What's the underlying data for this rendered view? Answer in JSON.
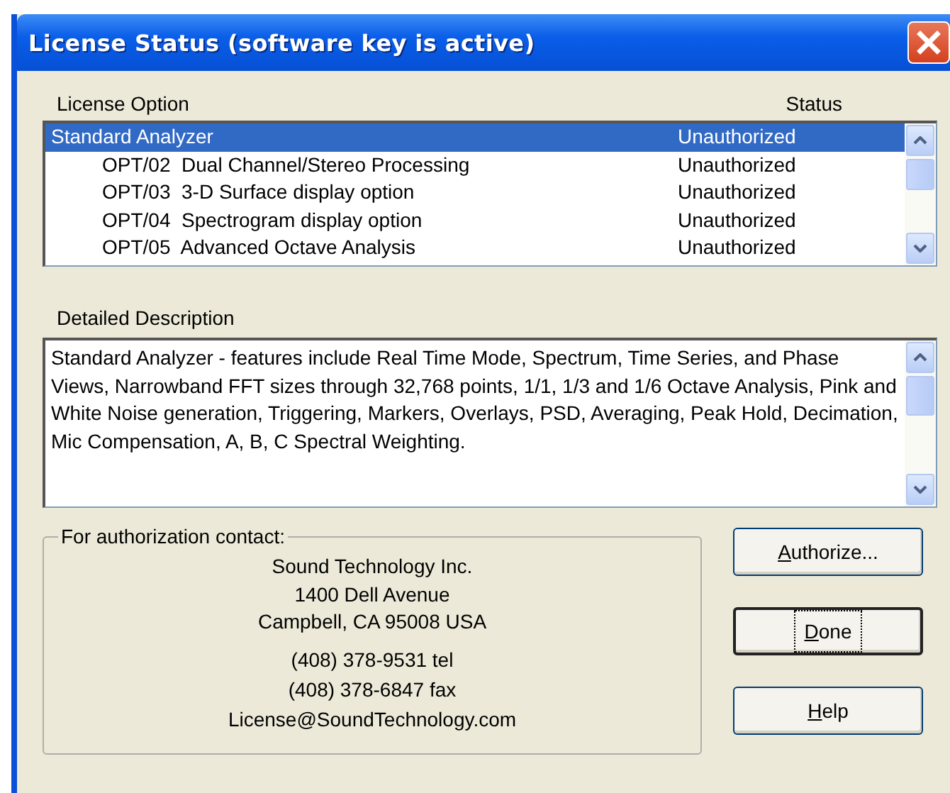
{
  "window": {
    "title": "License Status (software key is active)"
  },
  "license_list": {
    "columns": [
      "License Option",
      "Status"
    ],
    "rows": [
      {
        "name": "Standard Analyzer",
        "status": "Unauthorized",
        "selected": true,
        "children": [
          {
            "name": "OPT/02  Dual Channel/Stereo Processing",
            "status": "Unauthorized",
            "selected": false
          },
          {
            "name": "OPT/03  3-D Surface display option",
            "status": "Unauthorized",
            "selected": false
          },
          {
            "name": "OPT/04  Spectrogram display option",
            "status": "Unauthorized",
            "selected": false
          },
          {
            "name": "OPT/05  Advanced Octave Analysis",
            "status": "Unauthorized",
            "selected": false
          }
        ]
      }
    ]
  },
  "description": {
    "label": "Detailed Description",
    "text": "Standard Analyzer - features include Real Time Mode, Spectrum, Time Series, and Phase Views, Narrowband FFT sizes through 32,768 points, 1/1, 1/3 and 1/6 Octave Analysis, Pink and White Noise generation, Triggering, Markers, Overlays, PSD, Averaging, Peak Hold, Decimation, Mic Compensation, A, B, C Spectral Weighting."
  },
  "contact": {
    "label": "For authorization contact:",
    "address": [
      "Sound Technology Inc.",
      "1400 Dell Avenue",
      "Campbell, CA 95008 USA"
    ],
    "phones": [
      "(408) 378-9531 tel",
      "(408) 378-6847 fax"
    ],
    "email": "License@SoundTechnology.com"
  },
  "buttons": [
    {
      "label": "Authorize...",
      "default": false
    },
    {
      "label": "Done",
      "default": true
    },
    {
      "label": "Help",
      "default": false
    }
  ]
}
